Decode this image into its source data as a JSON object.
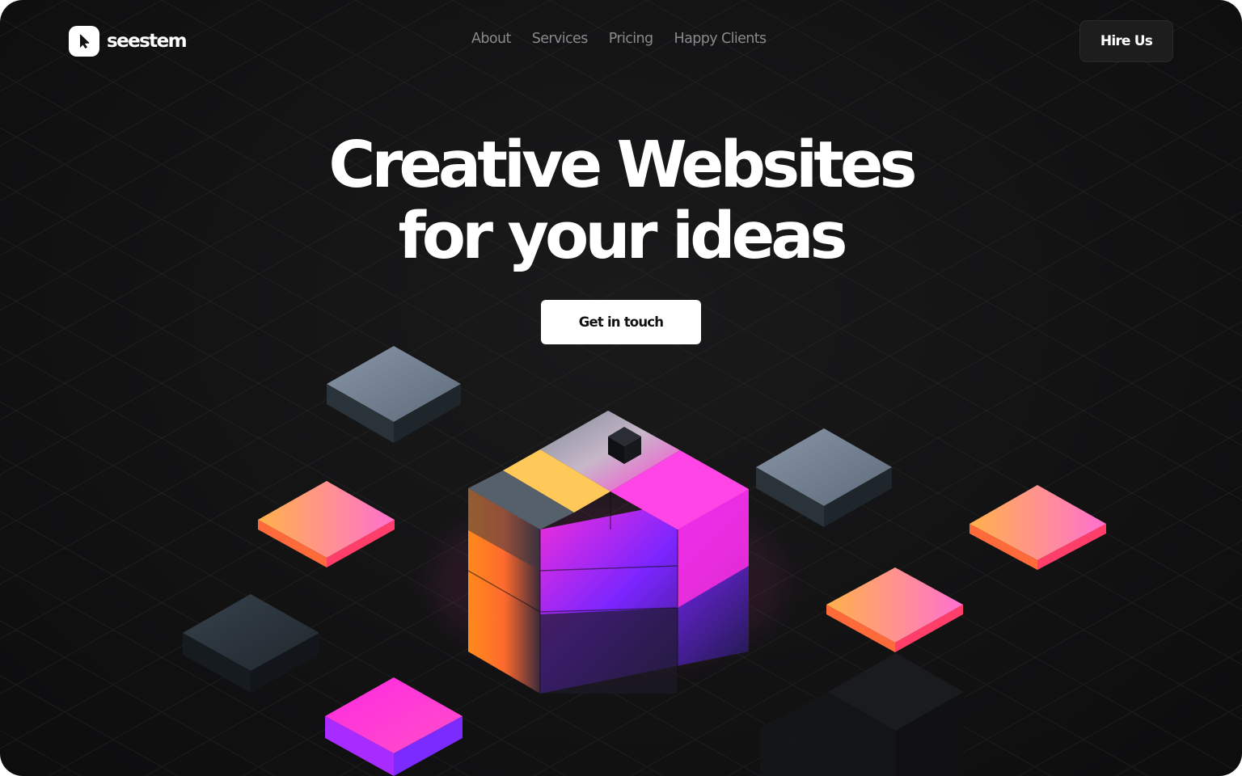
{
  "brand": {
    "name": "seestem",
    "logo_icon": "cursor-arrow-icon"
  },
  "nav": {
    "items": [
      {
        "label": "About"
      },
      {
        "label": "Services"
      },
      {
        "label": "Pricing"
      },
      {
        "label": "Happy Clients"
      }
    ],
    "cta_label": "Hire Us"
  },
  "hero": {
    "headline_line1": "Creative Websites",
    "headline_line2": "for your ideas",
    "cta_label": "Get in touch"
  },
  "colors": {
    "background": "#121213",
    "text": "#ffffff",
    "nav_text": "#8a8a8c",
    "accent_magenta": "#ff2fd6",
    "accent_orange": "#ff8a1f",
    "accent_yellow": "#ffd35a",
    "accent_blue": "#2a22ff",
    "tile_slate": "#6f7f90"
  }
}
